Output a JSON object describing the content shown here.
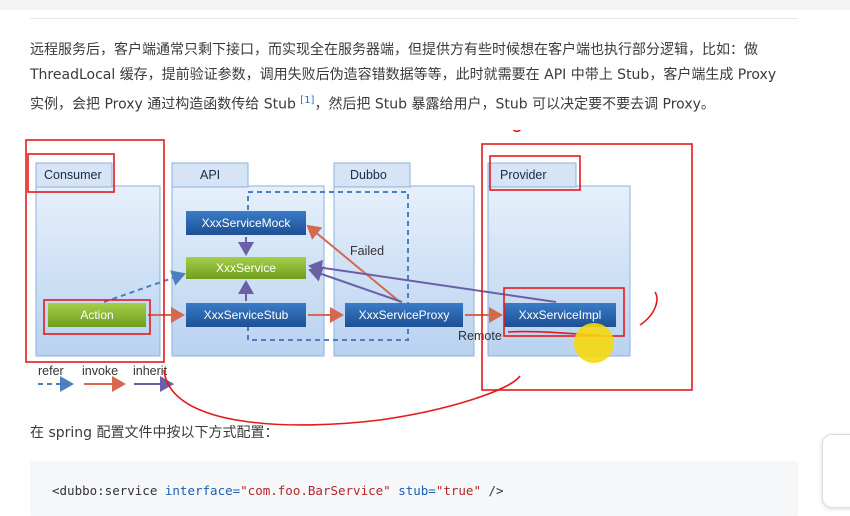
{
  "paragraph": {
    "text_before_sup": "远程服务后，客户端通常只剩下接口，而实现全在服务器端，但提供方有些时候想在客户端也执行部分逻辑，比如：做 ThreadLocal 缓存，提前验证参数，调用失败后伪造容错数据等等，此时就需要在 API 中带上 Stub，客户端生成 Proxy 实例，会把 Proxy 通过构造函数传给 Stub ",
    "sup": "[1]",
    "text_after_sup": "，然后把 Stub 暴露给用户，Stub 可以决定要不要去调 Proxy。"
  },
  "diagram": {
    "panels": {
      "consumer": "Consumer",
      "api": "API",
      "dubbo": "Dubbo",
      "provider": "Provider"
    },
    "nodes": {
      "mock": "XxxServiceMock",
      "service": "XxxService",
      "stub": "XxxServiceStub",
      "proxy": "XxxServiceProxy",
      "impl": "XxxServiceImpl",
      "action": "Action"
    },
    "labels": {
      "failed": "Failed",
      "remote": "Remote"
    },
    "legend": {
      "refer": "refer",
      "invoke": "invoke",
      "inherit": "inherit"
    },
    "colors": {
      "panel_fill": "#c9ddf5",
      "panel_border": "#8fb1dc",
      "node_blue": "#1f5fa8",
      "node_green": "#8cbc2d",
      "refer_arrow": "#4f7ec0",
      "invoke_arrow": "#d4694f",
      "inherit_arrow": "#6b5fa6",
      "annotation_red": "#e41a1a",
      "cursor_yellow": "#f5d80f"
    }
  },
  "paragraph2": "在 spring 配置文件中按以下方式配置：",
  "code": {
    "tag_open": "<dubbo:service",
    "attr1": " interface=",
    "val1": "\"com.foo.BarService\"",
    "attr2": " stub=",
    "val2": "\"true\"",
    "tag_close": " />"
  }
}
